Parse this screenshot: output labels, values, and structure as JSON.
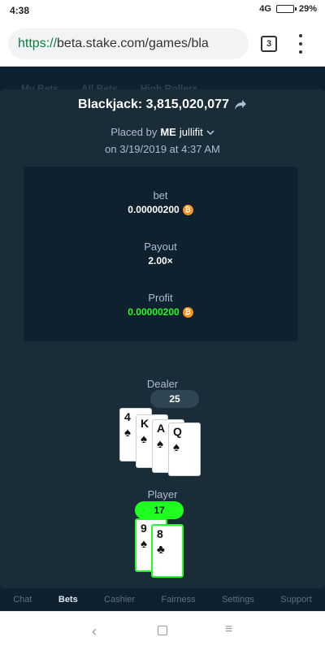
{
  "status_bar": {
    "time": "4:38",
    "network": "4G",
    "battery": "29%",
    "battery_level": 0.29
  },
  "browser": {
    "url_scheme": "https://",
    "url_rest": "beta.stake.com/games/bla",
    "tab_count": "3"
  },
  "background_tabs": [
    "My Bets",
    "All Bets",
    "High Rollers"
  ],
  "modal": {
    "title": "Blackjack: 3,815,020,077",
    "placed_by_prefix": "Placed by",
    "user_me": "ME",
    "user_name": "jullifit",
    "placed_on": "on 3/19/2019 at 4:37 AM"
  },
  "stats": {
    "bet_label": "bet",
    "bet_value": "0.00000200",
    "payout_label": "Payout",
    "payout_value": "2.00×",
    "profit_label": "Profit",
    "profit_value": "0.00000200",
    "currency_symbol": "₿"
  },
  "dealer": {
    "label": "Dealer",
    "score": "25",
    "cards": [
      {
        "rank": "4",
        "suit": "♠"
      },
      {
        "rank": "K",
        "suit": "♠"
      },
      {
        "rank": "A",
        "suit": "♠"
      },
      {
        "rank": "Q",
        "suit": "♠"
      }
    ]
  },
  "player": {
    "label": "Player",
    "score": "17",
    "cards": [
      {
        "rank": "9",
        "suit": "♠"
      },
      {
        "rank": "8",
        "suit": "♣"
      }
    ]
  },
  "app_nav": [
    "Chat",
    "Bets",
    "Cashier",
    "Fairness",
    "Settings",
    "Support"
  ],
  "colors": {
    "bg": "#0f212e",
    "panel": "#1a2c38",
    "win_green": "#1fff20",
    "btc_orange": "#f7931a"
  }
}
